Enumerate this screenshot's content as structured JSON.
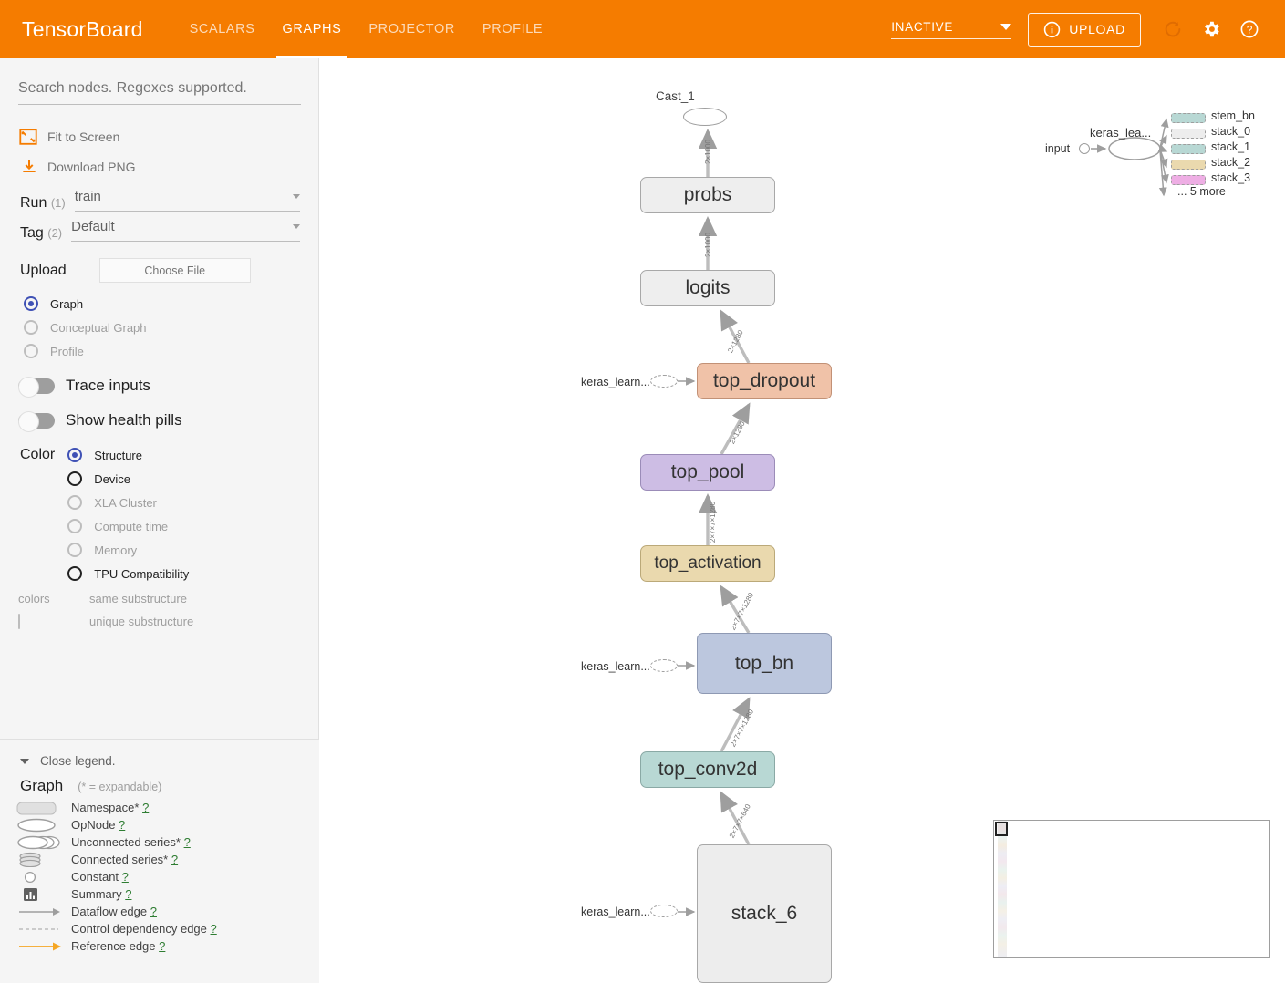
{
  "app": {
    "brand": "TensorBoard",
    "tabs": [
      {
        "label": "SCALARS",
        "active": false
      },
      {
        "label": "GRAPHS",
        "active": true
      },
      {
        "label": "PROJECTOR",
        "active": false
      },
      {
        "label": "PROFILE",
        "active": false
      }
    ],
    "run_status": "INACTIVE",
    "upload_label": "UPLOAD",
    "icons": {
      "info": "info-circle-icon",
      "refresh": "refresh-icon",
      "settings": "gear-icon",
      "help": "help-circle-icon",
      "caret": "chevron-down-icon"
    },
    "accent_color": "#f57c00"
  },
  "sidebar": {
    "search_placeholder": "Search nodes. Regexes supported.",
    "actions": [
      {
        "label": "Fit to Screen",
        "icon": "fit-to-screen-icon"
      },
      {
        "label": "Download PNG",
        "icon": "download-icon"
      }
    ],
    "run": {
      "label": "Run",
      "count": "(1)",
      "value": "train"
    },
    "tag": {
      "label": "Tag",
      "count": "(2)",
      "value": "Default"
    },
    "upload": {
      "label": "Upload",
      "button": "Choose File"
    },
    "source_options": [
      {
        "label": "Graph",
        "state": "selected"
      },
      {
        "label": "Conceptual Graph",
        "state": "disabled"
      },
      {
        "label": "Profile",
        "state": "disabled"
      }
    ],
    "toggles": [
      {
        "label": "Trace inputs",
        "on": false
      },
      {
        "label": "Show health pills",
        "on": false
      }
    ],
    "color": {
      "label": "Color",
      "options": [
        {
          "label": "Structure",
          "state": "selected"
        },
        {
          "label": "Device",
          "state": "enabled"
        },
        {
          "label": "XLA Cluster",
          "state": "disabled"
        },
        {
          "label": "Compute time",
          "state": "disabled"
        },
        {
          "label": "Memory",
          "state": "disabled"
        },
        {
          "label": "TPU Compatibility",
          "state": "enabled"
        }
      ],
      "legend_key": "colors",
      "same_substructure": "same substructure",
      "unique_substructure": "unique substructure"
    }
  },
  "legend": {
    "close_label": "Close legend.",
    "title": "Graph",
    "expandable_note": "(* = expandable)",
    "items": [
      {
        "label": "Namespace*",
        "help": "?",
        "icon": "namespace-rect-icon"
      },
      {
        "label": "OpNode",
        "help": "?",
        "icon": "opnode-ellipse-icon"
      },
      {
        "label": "Unconnected series*",
        "help": "?",
        "icon": "unconnected-series-icon"
      },
      {
        "label": "Connected series*",
        "help": "?",
        "icon": "connected-series-icon"
      },
      {
        "label": "Constant",
        "help": "?",
        "icon": "constant-circle-icon"
      },
      {
        "label": "Summary",
        "help": "?",
        "icon": "summary-chart-icon"
      },
      {
        "label": "Dataflow edge",
        "help": "?",
        "icon": "dataflow-arrow-icon"
      },
      {
        "label": "Control dependency edge",
        "help": "?",
        "icon": "control-dep-dashed-icon"
      },
      {
        "label": "Reference edge",
        "help": "?",
        "icon": "reference-arrow-icon"
      }
    ]
  },
  "graph": {
    "nodes": [
      {
        "id": "cast_1",
        "label": "Cast_1",
        "shape": "ellipse",
        "color": "#ffffff"
      },
      {
        "id": "probs",
        "label": "probs",
        "shape": "namespace",
        "color": "#eeeeee"
      },
      {
        "id": "logits",
        "label": "logits",
        "shape": "namespace",
        "color": "#eeeeee"
      },
      {
        "id": "top_dropout",
        "label": "top_dropout",
        "shape": "namespace",
        "color": "#f0c2a8"
      },
      {
        "id": "top_pool",
        "label": "top_pool",
        "shape": "namespace",
        "color": "#cdbde4"
      },
      {
        "id": "top_activation",
        "label": "top_activation",
        "shape": "namespace",
        "color": "#ead9ae"
      },
      {
        "id": "top_bn",
        "label": "top_bn",
        "shape": "namespace",
        "color": "#bcc7de"
      },
      {
        "id": "top_conv2d",
        "label": "top_conv2d",
        "shape": "namespace",
        "color": "#b8d8d4"
      },
      {
        "id": "stack_6",
        "label": "stack_6",
        "shape": "namespace",
        "color": "#ededed"
      }
    ],
    "input_stubs": [
      {
        "label": "keras_learn...",
        "target": "top_dropout"
      },
      {
        "label": "keras_learn...",
        "target": "top_bn"
      },
      {
        "label": "keras_learn...",
        "target": "stack_6"
      }
    ],
    "edges": [
      {
        "from": "probs",
        "to": "cast_1",
        "label": "2×1000"
      },
      {
        "from": "logits",
        "to": "probs",
        "label": "2×1000"
      },
      {
        "from": "top_dropout",
        "to": "logits",
        "label": "2×1280"
      },
      {
        "from": "top_pool",
        "to": "top_dropout",
        "label": "2×1280"
      },
      {
        "from": "top_activation",
        "to": "top_pool",
        "label": "2×7×7×1280"
      },
      {
        "from": "top_bn",
        "to": "top_activation",
        "label": "2×7×7×1280"
      },
      {
        "from": "top_conv2d",
        "to": "top_bn",
        "label": "2×7×7×1280"
      },
      {
        "from": "stack_6",
        "to": "top_conv2d",
        "label": "2×7×7×640"
      }
    ]
  },
  "info_card": {
    "input_label": "input",
    "hub_label": "keras_lea...",
    "outputs": [
      {
        "label": "stem_bn",
        "color": "#b8d8d4"
      },
      {
        "label": "stack_0",
        "color": "#ededed"
      },
      {
        "label": "stack_1",
        "color": "#b8d8d4"
      },
      {
        "label": "stack_2",
        "color": "#ead9ae"
      },
      {
        "label": "stack_3",
        "color": "#eeaee4"
      }
    ],
    "more_label": "... 5 more"
  }
}
